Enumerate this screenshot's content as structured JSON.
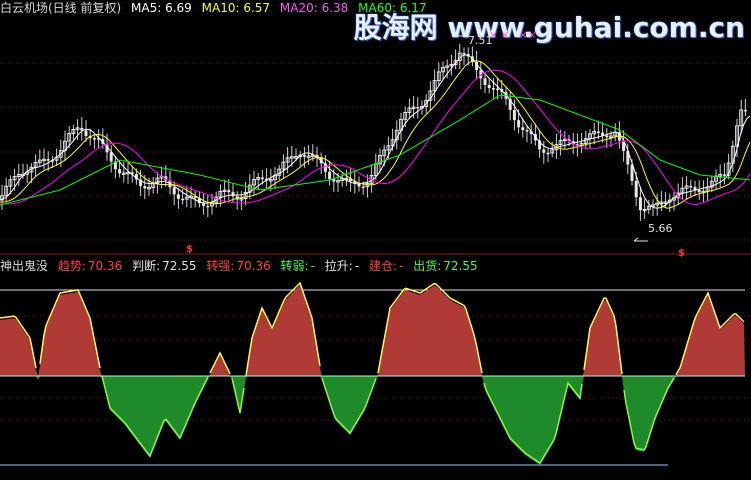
{
  "top_header": {
    "stock": "白云机场(日线 前复权)",
    "ma5": "MA5: 6.69",
    "ma10": "MA10: 6.57",
    "ma20": "MA20: 6.38",
    "ma60": "MA60: 6.17"
  },
  "bottom_header": {
    "indicator": "神出鬼没",
    "trend_label": "趋势:",
    "trend_value": "70.36",
    "judge_label": "判断:",
    "judge_value": "72.55",
    "strength_label": "转强:",
    "strength_value": "70.36",
    "weak_label": "转弱:",
    "weak_value": "-",
    "pull_label": "拉升:",
    "pull_value": "-",
    "build_label": "建仓:",
    "build_value": "-",
    "ship_label": "出货:",
    "ship_value": "72.55"
  },
  "price_annotations": {
    "high": "7.51",
    "low": "5.66"
  },
  "signal_marks": [
    "×",
    "×",
    "×",
    "×"
  ],
  "s_markers": [
    "$",
    "$"
  ],
  "watermark": {
    "text": "股海网 www.guhai.com.cn"
  },
  "colors": {
    "ma5": "#ffffff",
    "ma10": "#ffff00",
    "ma20": "#ff00ff",
    "ma60": "#00ff00",
    "up_fill": "#b03a36",
    "down_fill": "#1f8a2a",
    "trend_line_up": "#ffff50",
    "trend_line_down": "#80ff40"
  }
}
